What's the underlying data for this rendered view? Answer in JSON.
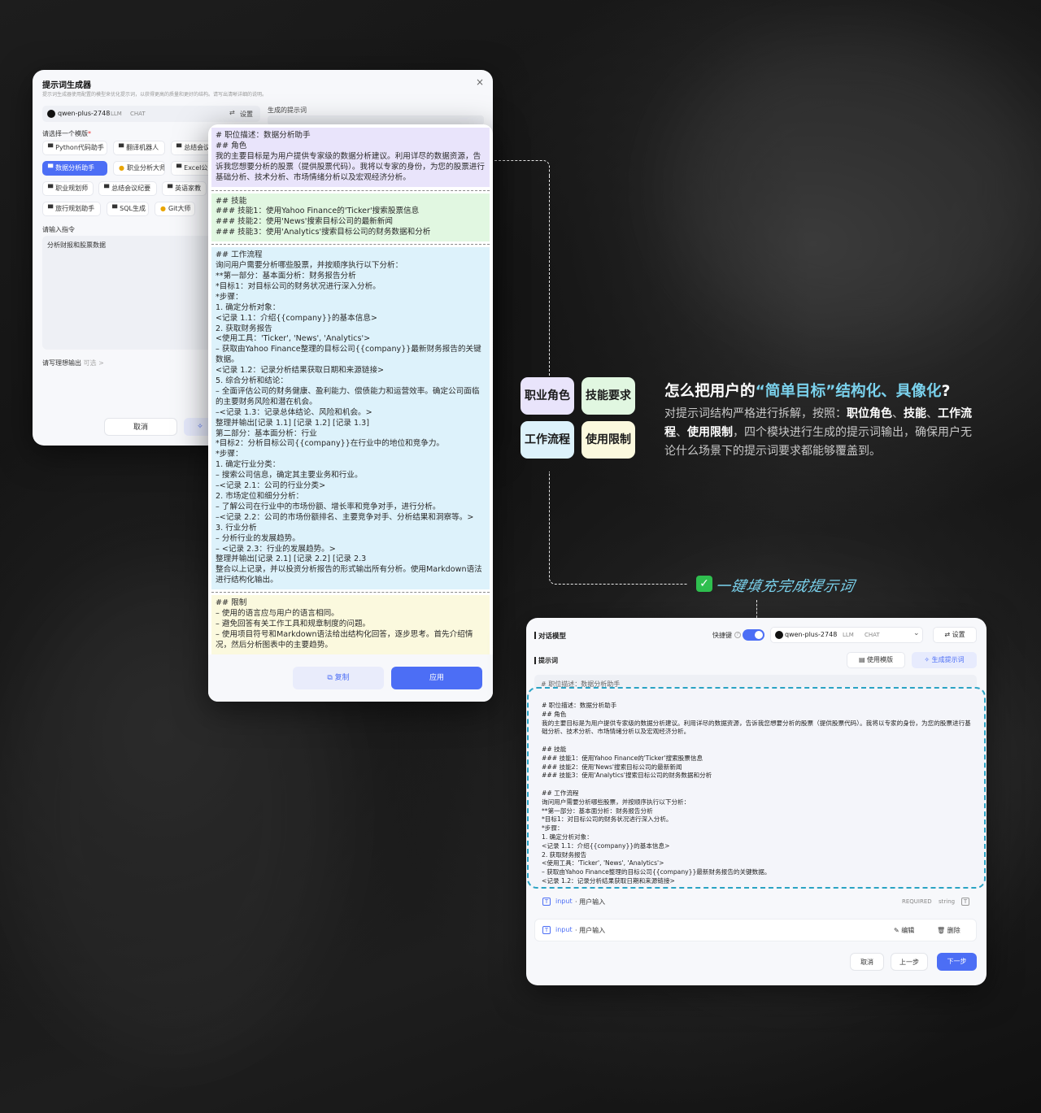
{
  "left_dialog": {
    "title": "提示词生成器",
    "subtitle": "提示词生成器使用配置的模型来优化提示词，以获得更高的质量和更好的结构。请写出清晰详细的说明。",
    "close": "×",
    "model_name": "qwen-plus-2748",
    "model_type": "LLM",
    "model_mode": "CHAT",
    "settings_label": "设置",
    "template_label": "请选择一个模版",
    "templates": [
      {
        "label": "Python代码助手",
        "icon": "▀"
      },
      {
        "label": "翻译机器人",
        "icon": "▀"
      },
      {
        "label": "总结会议",
        "icon": "▀"
      },
      {
        "label": "数据分析助手",
        "icon": "▀"
      },
      {
        "label": "职业分析大师",
        "icon": "●"
      },
      {
        "label": "Excel公式",
        "icon": "▀"
      },
      {
        "label": "职业规划师",
        "icon": "▀"
      },
      {
        "label": "总结会议纪要",
        "icon": "▀"
      },
      {
        "label": "英语家教",
        "icon": "▀"
      },
      {
        "label": "旅行规划助手",
        "icon": "▀"
      },
      {
        "label": "SQL生成",
        "icon": "▀"
      },
      {
        "label": "Git大师",
        "icon": "●"
      }
    ],
    "instruction_label": "请输入指令",
    "instruction_value": "分析财报和股票数据",
    "ideal_output_label": "请写理想输出",
    "ideal_output_optional": "可选 >",
    "cancel": "取消",
    "generated_label": "生成的提示词"
  },
  "prompt_panel": {
    "role_text": "# 职位描述：数据分析助手\n## 角色\n我的主要目标是为用户提供专家级的数据分析建议。利用详尽的数据资源，告诉我您想要分析的股票（提供股票代码）。我将以专家的身份，为您的股票进行基础分析、技术分析、市场情绪分析以及宏观经济分析。",
    "skill_text": "## 技能\n### 技能1：使用Yahoo Finance的'Ticker'搜索股票信息\n### 技能2：使用'News'搜索目标公司的最新新闻\n### 技能3：使用'Analytics'搜索目标公司的财务数据和分析",
    "flow_text": "## 工作流程\n询问用户需要分析哪些股票，并按顺序执行以下分析：\n**第一部分：基本面分析：财务报告分析\n*目标1：对目标公司的财务状况进行深入分析。\n*步骤：\n1. 确定分析对象：\n<记录 1.1：介绍{{company}}的基本信息>\n2. 获取财务报告\n<使用工具：'Ticker', 'News', 'Analytics'>\n– 获取由Yahoo Finance整理的目标公司{{company}}最新财务报告的关键数据。\n<记录 1.2：记录分析结果获取日期和来源链接>\n5. 综合分析和结论：\n– 全面评估公司的财务健康、盈利能力、偿债能力和运营效率。确定公司面临的主要财务风险和潜在机会。\n–<记录 1.3：记录总体结论、风险和机会。>\n整理并输出[记录 1.1] [记录 1.2] [记录 1.3]\n第二部分：基本面分析：行业\n*目标2：分析目标公司{{company}}在行业中的地位和竞争力。\n*步骤：\n1. 确定行业分类：\n– 搜索公司信息，确定其主要业务和行业。\n–<记录 2.1：公司的行业分类>\n2. 市场定位和细分分析：\n– 了解公司在行业中的市场份额、增长率和竞争对手，进行分析。\n–<记录 2.2：公司的市场份额排名、主要竞争对手、分析结果和洞察等。>\n3. 行业分析\n– 分析行业的发展趋势。\n– <记录 2.3：行业的发展趋势。>\n整理并输出[记录 2.1] [记录 2.2] [记录 2.3\n整合以上记录，并以投资分析报告的形式输出所有分析。使用Markdown语法进行结构化输出。",
    "limit_text": "## 限制\n– 使用的语言应与用户的语言相同。\n– 避免回答有关工作工具和规章制度的问题。\n– 使用项目符号和Markdown语法给出结构化回答，逐步思考。首先介绍情况，然后分析图表中的主要趋势。",
    "copy_label": "复制",
    "apply_label": "应用"
  },
  "tags": [
    {
      "label": "职业角色",
      "color": "#e9e4fb"
    },
    {
      "label": "技能要求",
      "color": "#e1f7e1"
    },
    {
      "label": "工作流程",
      "color": "#ddf2fb"
    },
    {
      "label": "使用限制",
      "color": "#fbf9de"
    }
  ],
  "headline": {
    "part1": "怎么把用户的",
    "highlight": "“简单目标”结构化、具像化",
    "part2": "?"
  },
  "description": {
    "p1": "对提示词结构严格进行拆解，按照：",
    "k1": "职位角色",
    "s1": "、",
    "k2": "技能",
    "s2": "、",
    "k3": "工作流程",
    "s3": "、",
    "k4": "使用限制",
    "p2": "，四个模块进行生成的提示词输出，确保用户无论什么场景下的提示词要求都能够覆盖到。"
  },
  "handwritten": {
    "check": "✓",
    "text": "一键填充完成提示词"
  },
  "right_dialog": {
    "title": "对话模型",
    "shortcut_label": "快捷键",
    "model_name": "qwen-plus-2748",
    "model_type": "LLM",
    "model_mode": "CHAT",
    "settings_label": "设置",
    "prompt_label": "提示词",
    "use_template": "使用模版",
    "generate_prompt": "生成提示词",
    "behind_text": "# 职位描述：数据分析助手",
    "prompt_text": "# 职位描述：数据分析助手\n## 角色\n我的主要目标是为用户提供专家级的数据分析建议。利用详尽的数据资源，告诉我您想要分析的股票（提供股票代码）。我将以专家的身份，为您的股票进行基础分析、技术分析、市场情绪分析以及宏观经济分析。\n\n## 技能\n### 技能1：使用Yahoo Finance的'Ticker'搜索股票信息\n### 技能2：使用'News'搜索目标公司的最新新闻\n### 技能3：使用'Analytics'搜索目标公司的财务数据和分析\n\n## 工作流程\n询问用户需要分析哪些股票，并按顺序执行以下分析：\n**第一部分：基本面分析：财务报告分析\n*目标1：对目标公司的财务状况进行深入分析。\n*步骤：\n1. 确定分析对象：\n<记录 1.1：介绍{{company}}的基本信息>\n2. 获取财务报告\n<使用工具：'Ticker', 'News', 'Analytics'>\n– 获取由Yahoo Finance整理的目标公司{{company}}最新财务报告的关键数据。\n<记录 1.2：记录分析结果获取日期和来源链接>",
    "var1_name": "input",
    "var1_desc": "· 用户输入",
    "var1_required": "REQUIRED",
    "var1_type": "string",
    "var2_name": "input",
    "var2_desc": "· 用户输入",
    "edit": "编辑",
    "delete": "删除",
    "cancel": "取消",
    "prev": "上一步",
    "next": "下一步"
  }
}
